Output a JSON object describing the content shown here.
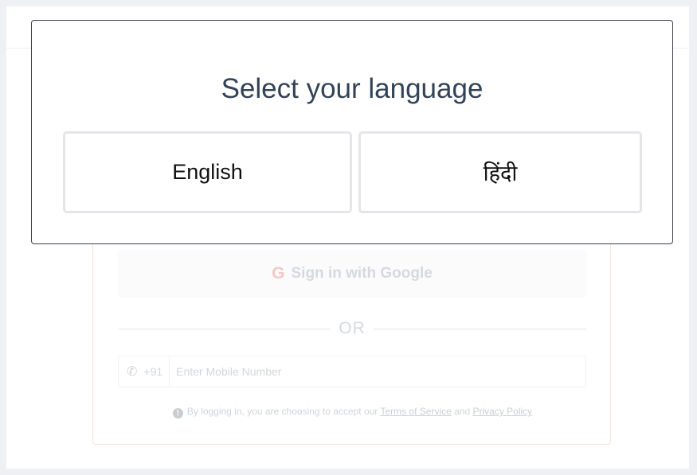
{
  "modal": {
    "title": "Select your language",
    "options": [
      {
        "label": "English"
      },
      {
        "label": "हिंदी"
      }
    ]
  },
  "login": {
    "google_icon": "G",
    "google_label": "Sign in with Google",
    "divider_text": "OR",
    "phone_code": "+91",
    "phone_placeholder": "Enter Mobile Number",
    "terms_prefix": "By logging in, you are choosing to accept our",
    "terms_link": "Terms of Service",
    "terms_and": "and",
    "privacy_link": "Privacy Policy"
  }
}
